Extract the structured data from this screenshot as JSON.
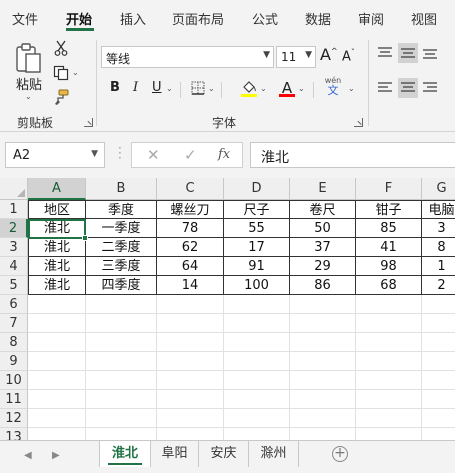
{
  "ribbon_tabs": [
    {
      "label": "文件"
    },
    {
      "label": "开始"
    },
    {
      "label": "插入"
    },
    {
      "label": "页面布局"
    },
    {
      "label": "公式"
    },
    {
      "label": "数据"
    },
    {
      "label": "审阅"
    },
    {
      "label": "视图"
    }
  ],
  "active_tab": "开始",
  "clipboard": {
    "paste_label": "粘贴",
    "group_label": "剪贴板"
  },
  "font": {
    "group_label": "字体",
    "font_name": "等线",
    "font_size": "11",
    "bold": "B",
    "italic": "I",
    "underline": "U",
    "grow": "A",
    "shrink": "A",
    "phonetic": "wén",
    "font_color_letter": "A"
  },
  "colors": {
    "accent": "#217346",
    "fill_highlight": "#ffff00",
    "font_color": "#ff0000"
  },
  "formula_bar": {
    "name_box": "A2",
    "cancel": "✕",
    "enter": "✓",
    "fx": "fx",
    "value": "淮北"
  },
  "columns": [
    "A",
    "B",
    "C",
    "D",
    "E",
    "F",
    "G"
  ],
  "row_numbers": [
    "1",
    "2",
    "3",
    "4",
    "5",
    "6",
    "7",
    "8",
    "9",
    "10",
    "11",
    "12",
    "13"
  ],
  "table": {
    "headers": [
      "地区",
      "季度",
      "螺丝刀",
      "尺子",
      "卷尺",
      "钳子",
      "电脑"
    ],
    "rows": [
      [
        "淮北",
        "一季度",
        "78",
        "55",
        "50",
        "85",
        "3"
      ],
      [
        "淮北",
        "二季度",
        "62",
        "17",
        "37",
        "41",
        "8"
      ],
      [
        "淮北",
        "三季度",
        "64",
        "91",
        "29",
        "98",
        "1"
      ],
      [
        "淮北",
        "四季度",
        "14",
        "100",
        "86",
        "68",
        "2"
      ]
    ]
  },
  "sheets": [
    {
      "label": "淮北",
      "active": true
    },
    {
      "label": "阜阳",
      "active": false
    },
    {
      "label": "安庆",
      "active": false
    },
    {
      "label": "滁州",
      "active": false
    }
  ],
  "add_sheet": "+"
}
